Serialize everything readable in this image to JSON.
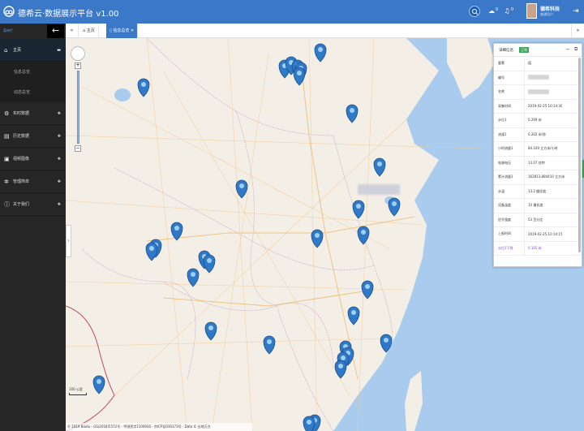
{
  "header": {
    "title": "德希云·数据展示平台 v1.00",
    "badges": [
      "0",
      "0"
    ],
    "user_name": "德希科技",
    "user_role": "普通用户"
  },
  "sidebar": {
    "top_label": "菜单栏",
    "items": [
      {
        "label": "主页",
        "icon": "home-icon",
        "expanded": true
      },
      {
        "label": "实时数据",
        "icon": "gear-icon"
      },
      {
        "label": "历史数据",
        "icon": "chart-icon"
      },
      {
        "label": "视频图像",
        "icon": "video-icon"
      },
      {
        "label": "管理简单",
        "icon": "settings-icon"
      },
      {
        "label": "关于我们",
        "icon": "info-icon"
      }
    ],
    "sub_items": [
      "信息总览",
      "动态总览"
    ]
  },
  "tabs": [
    {
      "label": "主页"
    },
    {
      "label": "信息总览",
      "active": true
    }
  ],
  "map": {
    "scale_label": "100 公里",
    "copyright": "© 2019 Baidu - GS(2018)5572号 - 甲测资字1100930 - 京ICP证030173号 - Data © 长地万方"
  },
  "panel": {
    "title": "详细信息",
    "status": "正常",
    "rows": [
      {
        "key": "要素",
        "value": "值"
      },
      {
        "key": "编号",
        "value": ""
      },
      {
        "key": "名称",
        "value": ""
      },
      {
        "key": "采集时间",
        "value": "2019-02-25 10:14:30"
      },
      {
        "key": "水位1",
        "value": "0.269 米"
      },
      {
        "key": "流速1",
        "value": "0.202 米/秒"
      },
      {
        "key": "小时流量1",
        "value": "84.100 立方米/小时"
      },
      {
        "key": "电源电压",
        "value": "13.07 伏特"
      },
      {
        "key": "累计流量1",
        "value": "162813.884410 立方米"
      },
      {
        "key": "水温",
        "value": "13.2 摄氏度"
      },
      {
        "key": "设备温度",
        "value": "10 摄氏度"
      },
      {
        "key": "信号强度",
        "value": "53 百分比"
      },
      {
        "key": "上报时间",
        "value": "2019-02-25 10:14:15"
      },
      {
        "key": "水位1下限",
        "value": "0.105 米",
        "highlight": true
      }
    ]
  },
  "colors": {
    "header": "#3c78c8",
    "sidebar": "#262626",
    "sea": "#a9cbee",
    "land": "#f3efe6",
    "marker": "#2f79c6",
    "status_ok": "#3aa55a"
  },
  "markers": [
    {
      "label": "station-01"
    },
    {
      "label": "station-02"
    },
    {
      "label": "station-03"
    },
    {
      "label": "station-04"
    },
    {
      "label": "station-05"
    },
    {
      "label": "station-06"
    },
    {
      "label": "station-07"
    },
    {
      "label": "station-08"
    },
    {
      "label": "station-09"
    },
    {
      "label": "station-10"
    },
    {
      "label": "station-11"
    },
    {
      "label": "station-12"
    },
    {
      "label": "station-13"
    },
    {
      "label": "station-14"
    },
    {
      "label": "station-15"
    },
    {
      "label": "station-16"
    },
    {
      "label": "station-17"
    },
    {
      "label": "station-18"
    },
    {
      "label": "station-19"
    },
    {
      "label": "station-20"
    },
    {
      "label": "station-21"
    },
    {
      "label": "station-22"
    },
    {
      "label": "station-23"
    },
    {
      "label": "station-24"
    },
    {
      "label": "station-25"
    },
    {
      "label": "station-26"
    },
    {
      "label": "station-27"
    },
    {
      "label": "station-28"
    },
    {
      "label": "station-29"
    },
    {
      "label": "station-30"
    },
    {
      "label": "station-31"
    },
    {
      "label": "station-32"
    }
  ]
}
